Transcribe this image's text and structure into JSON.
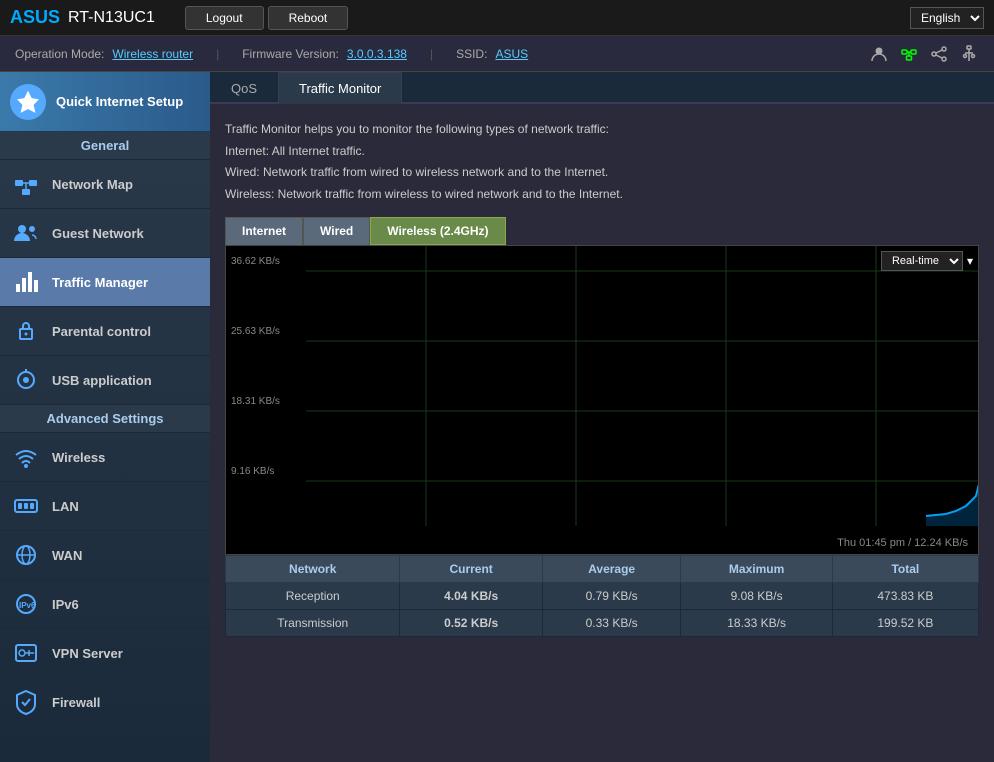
{
  "topbar": {
    "brand": "ASUS",
    "model": "RT-N13UC1",
    "logout_label": "Logout",
    "reboot_label": "Reboot",
    "language": "English"
  },
  "infobar": {
    "operation_mode_label": "Operation Mode:",
    "operation_mode_value": "Wireless router",
    "firmware_label": "Firmware Version:",
    "firmware_value": "3.0.0.3.138",
    "ssid_label": "SSID:",
    "ssid_value": "ASUS"
  },
  "sidebar": {
    "quick_setup_label": "Quick Internet Setup",
    "general_label": "General",
    "nav_items": [
      {
        "id": "network-map",
        "label": "Network Map"
      },
      {
        "id": "guest-network",
        "label": "Guest Network"
      },
      {
        "id": "traffic-manager",
        "label": "Traffic Manager"
      },
      {
        "id": "parental-control",
        "label": "Parental control"
      },
      {
        "id": "usb-application",
        "label": "USB application"
      }
    ],
    "advanced_label": "Advanced Settings",
    "advanced_items": [
      {
        "id": "wireless",
        "label": "Wireless"
      },
      {
        "id": "lan",
        "label": "LAN"
      },
      {
        "id": "wan",
        "label": "WAN"
      },
      {
        "id": "ipv6",
        "label": "IPv6"
      },
      {
        "id": "vpn-server",
        "label": "VPN Server"
      },
      {
        "id": "firewall",
        "label": "Firewall"
      }
    ]
  },
  "tabs": [
    {
      "id": "qos",
      "label": "QoS"
    },
    {
      "id": "traffic-monitor",
      "label": "Traffic Monitor"
    }
  ],
  "traffic_monitor": {
    "description_lines": [
      "Traffic Monitor helps you to monitor the following types of network traffic:",
      "Internet: All Internet traffic.",
      "Wired: Network traffic from wired to wireless network and to the Internet.",
      "Wireless: Network traffic from wireless to wired network and to the Internet."
    ],
    "sub_tabs": [
      {
        "id": "internet",
        "label": "Internet"
      },
      {
        "id": "wired",
        "label": "Wired"
      },
      {
        "id": "wireless",
        "label": "Wireless (2.4GHz)"
      }
    ],
    "chart": {
      "y_labels": [
        "36.62 KB/s",
        "25.63 KB/s",
        "18.31 KB/s",
        "9.16 KB/s"
      ],
      "timestamp": "Thu 01:45 pm / 12.24 KB/s",
      "realtime_option": "Real-time"
    },
    "table": {
      "headers": [
        "Network",
        "Current",
        "Average",
        "Maximum",
        "Total"
      ],
      "rows": [
        {
          "network": "Reception",
          "current": "4.04 KB/s",
          "current_class": "val-orange",
          "average": "0.79 KB/s",
          "maximum": "9.08 KB/s",
          "total": "473.83 KB"
        },
        {
          "network": "Transmission",
          "current": "0.52 KB/s",
          "current_class": "val-blue",
          "average": "0.33 KB/s",
          "maximum": "18.33 KB/s",
          "total": "199.52 KB"
        }
      ]
    }
  }
}
